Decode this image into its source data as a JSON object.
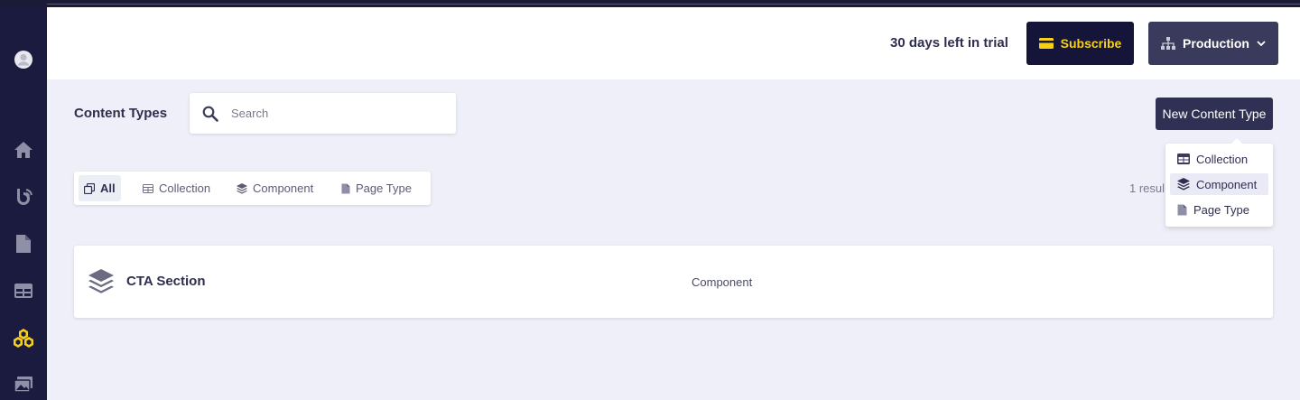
{
  "header": {
    "trial_text": "30 days left in trial",
    "subscribe_label": "Subscribe",
    "environment_label": "Production"
  },
  "sidebar": {
    "items": [
      {
        "icon": "avatar-icon",
        "active": false
      },
      {
        "icon": "home-icon",
        "active": false
      },
      {
        "icon": "blog-icon",
        "active": false
      },
      {
        "icon": "document-icon",
        "active": false
      },
      {
        "icon": "table-icon",
        "active": false
      },
      {
        "icon": "content-types-icon",
        "active": true
      },
      {
        "icon": "media-icon",
        "active": false
      }
    ]
  },
  "main": {
    "title": "Content Types",
    "search_placeholder": "Search",
    "new_button_label": "New Content Type",
    "new_menu": [
      {
        "label": "Collection",
        "icon": "table-icon",
        "highlighted": false
      },
      {
        "label": "Component",
        "icon": "layers-icon",
        "highlighted": true
      },
      {
        "label": "Page Type",
        "icon": "document-icon",
        "highlighted": false
      }
    ],
    "filters": [
      {
        "label": "All",
        "icon": "copy-icon",
        "active": true
      },
      {
        "label": "Collection",
        "icon": "table-icon",
        "active": false
      },
      {
        "label": "Component",
        "icon": "layers-icon",
        "active": false
      },
      {
        "label": "Page Type",
        "icon": "document-icon",
        "active": false
      }
    ],
    "results_text": "1 resul",
    "items": [
      {
        "title": "CTA Section",
        "type": "Component",
        "icon": "layers-icon"
      }
    ]
  },
  "colors": {
    "sidebar_bg": "#1b1b3f",
    "accent_yellow": "#f7d117",
    "page_bg": "#eeeff8"
  }
}
